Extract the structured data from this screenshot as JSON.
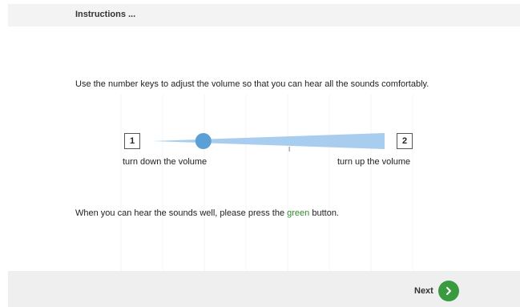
{
  "header": {
    "title": "Instructions ..."
  },
  "main": {
    "instruction": "Use the number keys to adjust the volume so that you can hear all the sounds comfortably.",
    "volume": {
      "left_key": "1",
      "right_key": "2",
      "left_label": "turn down the volume",
      "right_label": "turn up the volume",
      "level_fraction": 0.22,
      "track_color": "#a8cdee",
      "knob_color": "#5b9fd6"
    },
    "note_prefix": "When you can hear the sounds well, please press the ",
    "note_highlight": "green",
    "note_suffix": " button.",
    "note_highlight_color": "#2e8b2e"
  },
  "footer": {
    "next_label": "Next",
    "next_icon": "chevron-right-icon",
    "next_color": "#3a9a3f"
  }
}
